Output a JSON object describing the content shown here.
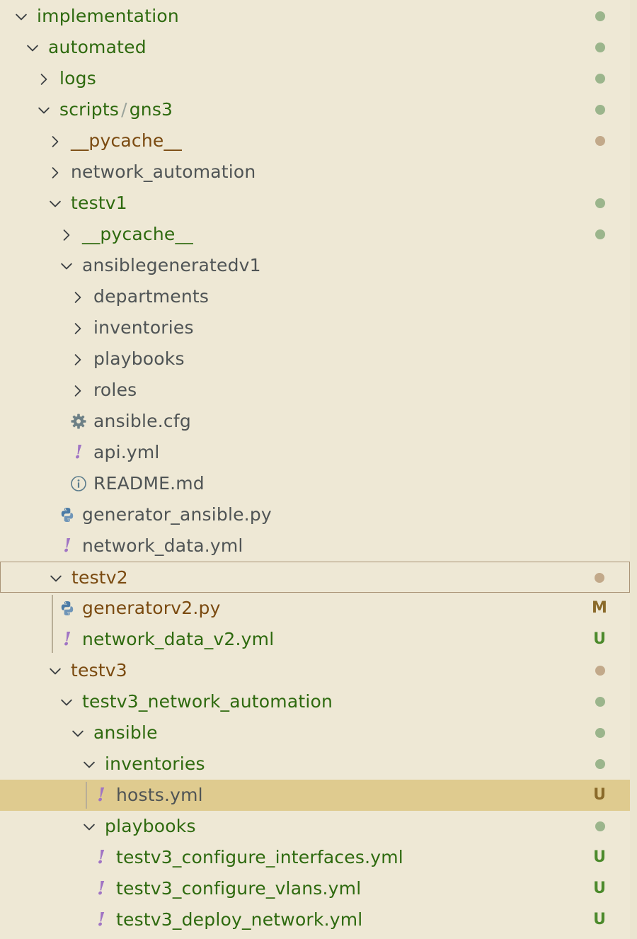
{
  "tree": [
    {
      "label": "implementation",
      "twistie": "expanded",
      "color": "green",
      "decoration": "dot-green"
    },
    {
      "label": "automated",
      "twistie": "expanded",
      "color": "green",
      "decoration": "dot-green"
    },
    {
      "label": "logs",
      "twistie": "collapsed",
      "color": "green",
      "decoration": "dot-green"
    },
    {
      "label": "scripts",
      "label2": "gns3",
      "separator": "/",
      "twistie": "expanded",
      "color": "green",
      "decoration": "dot-green"
    },
    {
      "label": "__pycache__",
      "twistie": "collapsed",
      "color": "brown",
      "decoration": "dot-brown"
    },
    {
      "label": "network_automation",
      "twistie": "collapsed",
      "color": "gray",
      "decoration": "none"
    },
    {
      "label": "testv1",
      "twistie": "expanded",
      "color": "green",
      "decoration": "dot-green"
    },
    {
      "label": "__pycache__",
      "twistie": "collapsed",
      "color": "green",
      "decoration": "dot-green"
    },
    {
      "label": "ansiblegeneratedv1",
      "twistie": "expanded",
      "color": "gray",
      "decoration": "none"
    },
    {
      "label": "departments",
      "twistie": "collapsed",
      "color": "gray",
      "decoration": "none"
    },
    {
      "label": "inventories",
      "twistie": "collapsed",
      "color": "gray",
      "decoration": "none"
    },
    {
      "label": "playbooks",
      "twistie": "collapsed",
      "color": "gray",
      "decoration": "none"
    },
    {
      "label": "roles",
      "twistie": "collapsed",
      "color": "gray",
      "decoration": "none"
    },
    {
      "label": "ansible.cfg",
      "icon": "gear-icon",
      "color": "gray",
      "decoration": "none"
    },
    {
      "label": "api.yml",
      "icon": "yaml-icon",
      "color": "gray",
      "decoration": "none"
    },
    {
      "label": "README.md",
      "icon": "info-icon",
      "color": "gray",
      "decoration": "none"
    },
    {
      "label": "generator_ansible.py",
      "icon": "python-icon",
      "color": "gray",
      "decoration": "none"
    },
    {
      "label": "network_data.yml",
      "icon": "yaml-icon",
      "color": "gray",
      "decoration": "none"
    },
    {
      "label": "testv2",
      "twistie": "expanded",
      "color": "brown",
      "decoration": "dot-brown",
      "state": "focused"
    },
    {
      "label": "generatorv2.py",
      "icon": "python-icon",
      "color": "brown",
      "decoration": "badge",
      "badge": "M",
      "badge_color": "brown"
    },
    {
      "label": "network_data_v2.yml",
      "icon": "yaml-icon",
      "color": "green",
      "decoration": "badge",
      "badge": "U",
      "badge_color": "green"
    },
    {
      "label": "testv3",
      "twistie": "expanded",
      "color": "brown",
      "decoration": "dot-brown"
    },
    {
      "label": "testv3_network_automation",
      "twistie": "expanded",
      "color": "green",
      "decoration": "dot-green"
    },
    {
      "label": "ansible",
      "twistie": "expanded",
      "color": "green",
      "decoration": "dot-green"
    },
    {
      "label": "inventories",
      "twistie": "expanded",
      "color": "green",
      "decoration": "dot-green"
    },
    {
      "label": "hosts.yml",
      "icon": "yaml-icon",
      "color": "gray",
      "decoration": "badge",
      "badge": "U",
      "badge_color": "brown",
      "state": "selected"
    },
    {
      "label": "playbooks",
      "twistie": "expanded",
      "color": "green",
      "decoration": "dot-green"
    },
    {
      "label": "testv3_configure_interfaces.yml",
      "icon": "yaml-icon",
      "color": "green",
      "decoration": "badge",
      "badge": "U",
      "badge_color": "green"
    },
    {
      "label": "testv3_configure_vlans.yml",
      "icon": "yaml-icon",
      "color": "green",
      "decoration": "badge",
      "badge": "U",
      "badge_color": "green"
    },
    {
      "label": "testv3_deploy_network.yml",
      "icon": "yaml-icon",
      "color": "green",
      "decoration": "badge",
      "badge": "U",
      "badge_color": "green"
    }
  ],
  "colors": {
    "background": "#eee8d5",
    "selected_background": "#dfcb8f",
    "focus_border": "#a99376",
    "text_green": "#2e6a0f",
    "text_brown": "#7a4a10",
    "text_gray": "#4f5455",
    "dot_green": "#9bb58c",
    "dot_brown": "#c2a98a"
  }
}
